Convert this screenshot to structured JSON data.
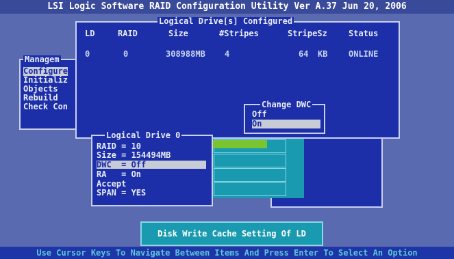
{
  "title_bar": "LSI Logic Software RAID Configuration Utility Ver A.37 Jun 20, 2006",
  "status_bar": "Use Cursor Keys To Navigate Between Items And Press Enter To Select An Option",
  "menu": {
    "legend": "Managem",
    "items": [
      "Configure",
      "Initializ",
      "Objects",
      "Rebuild",
      "Check Con"
    ]
  },
  "logical_drives": {
    "legend": "Logical Drive[s] Configured",
    "headers": {
      "ld": "LD",
      "raid": "RAID",
      "size": "Size",
      "stripes": "#Stripes",
      "stripe_sz": "StripeSz",
      "status": "Status"
    },
    "rows": [
      {
        "ld": "0",
        "raid": "0",
        "size": "308988MB",
        "stripes": "4",
        "stripe_sz": "64",
        "stripe_unit": "KB",
        "status": "ONLINE"
      }
    ]
  },
  "change_dwc": {
    "legend": "Change DWC",
    "options": [
      "Off",
      "On"
    ],
    "selected": "On"
  },
  "logical_drive_0": {
    "legend": "Logical Drive 0",
    "rows": [
      "RAID = 10",
      "Size = 154494MB",
      "DWC  = Off",
      "RA   = On",
      "Accept",
      "SPAN = YES"
    ]
  },
  "help_text": "Disk Write Cache Setting Of LD",
  "colors": {
    "background": "#5a6ab0",
    "panel": "#1c2ea8",
    "highlight": "#c8ccd6",
    "teal": "#1a9ab0",
    "status_text": "#5cc6d8"
  }
}
